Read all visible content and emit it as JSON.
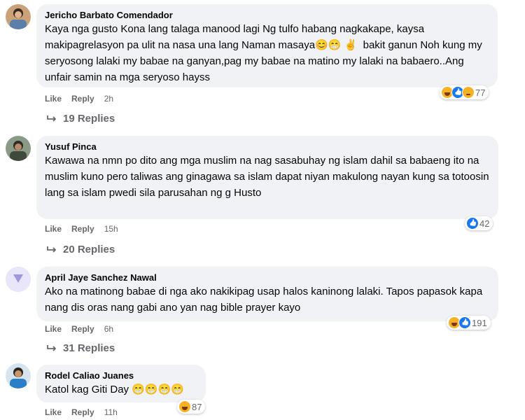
{
  "actions": {
    "like": "Like",
    "reply": "Reply"
  },
  "comments": [
    {
      "author": "Jericho Barbato Comendador",
      "text": "Kaya nga gusto Kona lang talaga manood lagi Ng tulfo habang nagkakape, kaysa makipagrelasyon pa ulit na nasa una lang Naman masaya😊😁 ✌️  bakit ganun Noh kung my seryosong lalaki my babae na ganyan,pag my babae na matino my lalaki na babaero..Ang unfair samin na mga seryoso hayss",
      "time": "2h",
      "reaction_count": "77",
      "reactions": [
        "haha",
        "like",
        "sad"
      ],
      "replies": "19 Replies"
    },
    {
      "author": "Yusuf Pinca",
      "text": "Kawawa na nmn po dito ang mga muslim na nag sasabuhay ng islam dahil sa babaeng ito na muslim kuno pero taliwas ang ginagawa sa islam dapat niyan makulong nayan kung sa totoosin lang sa islam pwedi sila parusahan ng g Husto",
      "time": "15h",
      "reaction_count": "42",
      "reactions": [
        "like"
      ],
      "replies": "20 Replies"
    },
    {
      "author": "April Jaye Sanchez Nawal",
      "text": "Ako na matinong babae di nga ako nakikipag usap halos kaninong lalaki. Tapos papasok kapa nang dis oras nang gabi ano yan nag bible prayer kayo",
      "time": "6h",
      "reaction_count": "191",
      "reactions": [
        "haha",
        "like"
      ],
      "replies": "31 Replies"
    },
    {
      "author": "Rodel Caliao Juanes",
      "text": "Katol kag Giti Day 😁😁😁😁",
      "time": "11h",
      "reaction_count": "87",
      "reactions": [
        "haha"
      ],
      "replies": ""
    }
  ],
  "icons": {
    "reply_arrow": "reply-arrow-icon",
    "like": "like-reaction-icon",
    "haha": "haha-reaction-icon",
    "sad": "sad-reaction-icon"
  },
  "colors": {
    "bubble": "#f0f2f5",
    "secondary_text": "#65676b",
    "like_blue": "#1877f2",
    "emoji_yellow": "#f7b125"
  }
}
